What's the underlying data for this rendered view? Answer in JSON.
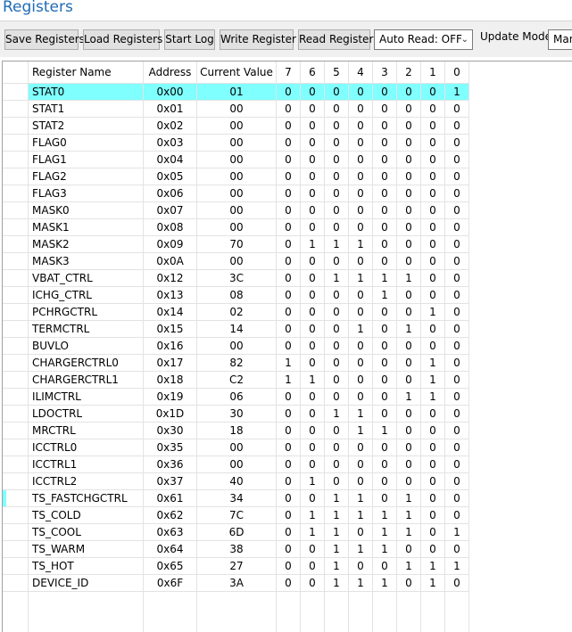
{
  "header": {
    "title": "Registers"
  },
  "toolbar": {
    "save_label": "Save Registers",
    "load_label": "Load Registers",
    "start_log_label": "Start Log",
    "write_label": "Write Register",
    "read_label": "Read Register",
    "auto_read_value": "Auto Read: OFF",
    "update_mode_label": "Update Mode",
    "update_mode_value": "Man"
  },
  "table": {
    "columns": [
      "Register Name",
      "Address",
      "Current Value",
      "7",
      "6",
      "5",
      "4",
      "3",
      "2",
      "1",
      "0"
    ],
    "selected_index": 0,
    "rows": [
      {
        "name": "STAT0",
        "address": "0x00",
        "value": "01",
        "bits": [
          "0",
          "0",
          "0",
          "0",
          "0",
          "0",
          "0",
          "1"
        ]
      },
      {
        "name": "STAT1",
        "address": "0x01",
        "value": "00",
        "bits": [
          "0",
          "0",
          "0",
          "0",
          "0",
          "0",
          "0",
          "0"
        ]
      },
      {
        "name": "STAT2",
        "address": "0x02",
        "value": "00",
        "bits": [
          "0",
          "0",
          "0",
          "0",
          "0",
          "0",
          "0",
          "0"
        ]
      },
      {
        "name": "FLAG0",
        "address": "0x03",
        "value": "00",
        "bits": [
          "0",
          "0",
          "0",
          "0",
          "0",
          "0",
          "0",
          "0"
        ]
      },
      {
        "name": "FLAG1",
        "address": "0x04",
        "value": "00",
        "bits": [
          "0",
          "0",
          "0",
          "0",
          "0",
          "0",
          "0",
          "0"
        ]
      },
      {
        "name": "FLAG2",
        "address": "0x05",
        "value": "00",
        "bits": [
          "0",
          "0",
          "0",
          "0",
          "0",
          "0",
          "0",
          "0"
        ]
      },
      {
        "name": "FLAG3",
        "address": "0x06",
        "value": "00",
        "bits": [
          "0",
          "0",
          "0",
          "0",
          "0",
          "0",
          "0",
          "0"
        ]
      },
      {
        "name": "MASK0",
        "address": "0x07",
        "value": "00",
        "bits": [
          "0",
          "0",
          "0",
          "0",
          "0",
          "0",
          "0",
          "0"
        ]
      },
      {
        "name": "MASK1",
        "address": "0x08",
        "value": "00",
        "bits": [
          "0",
          "0",
          "0",
          "0",
          "0",
          "0",
          "0",
          "0"
        ]
      },
      {
        "name": "MASK2",
        "address": "0x09",
        "value": "70",
        "bits": [
          "0",
          "1",
          "1",
          "1",
          "0",
          "0",
          "0",
          "0"
        ]
      },
      {
        "name": "MASK3",
        "address": "0x0A",
        "value": "00",
        "bits": [
          "0",
          "0",
          "0",
          "0",
          "0",
          "0",
          "0",
          "0"
        ]
      },
      {
        "name": "VBAT_CTRL",
        "address": "0x12",
        "value": "3C",
        "bits": [
          "0",
          "0",
          "1",
          "1",
          "1",
          "1",
          "0",
          "0"
        ]
      },
      {
        "name": "ICHG_CTRL",
        "address": "0x13",
        "value": "08",
        "bits": [
          "0",
          "0",
          "0",
          "0",
          "1",
          "0",
          "0",
          "0"
        ]
      },
      {
        "name": "PCHRGCTRL",
        "address": "0x14",
        "value": "02",
        "bits": [
          "0",
          "0",
          "0",
          "0",
          "0",
          "0",
          "1",
          "0"
        ]
      },
      {
        "name": "TERMCTRL",
        "address": "0x15",
        "value": "14",
        "bits": [
          "0",
          "0",
          "0",
          "1",
          "0",
          "1",
          "0",
          "0"
        ]
      },
      {
        "name": "BUVLO",
        "address": "0x16",
        "value": "00",
        "bits": [
          "0",
          "0",
          "0",
          "0",
          "0",
          "0",
          "0",
          "0"
        ]
      },
      {
        "name": "CHARGERCTRL0",
        "address": "0x17",
        "value": "82",
        "bits": [
          "1",
          "0",
          "0",
          "0",
          "0",
          "0",
          "1",
          "0"
        ]
      },
      {
        "name": "CHARGERCTRL1",
        "address": "0x18",
        "value": "C2",
        "bits": [
          "1",
          "1",
          "0",
          "0",
          "0",
          "0",
          "1",
          "0"
        ]
      },
      {
        "name": "ILIMCTRL",
        "address": "0x19",
        "value": "06",
        "bits": [
          "0",
          "0",
          "0",
          "0",
          "0",
          "1",
          "1",
          "0"
        ]
      },
      {
        "name": "LDOCTRL",
        "address": "0x1D",
        "value": "30",
        "bits": [
          "0",
          "0",
          "1",
          "1",
          "0",
          "0",
          "0",
          "0"
        ]
      },
      {
        "name": "MRCTRL",
        "address": "0x30",
        "value": "18",
        "bits": [
          "0",
          "0",
          "0",
          "1",
          "1",
          "0",
          "0",
          "0"
        ]
      },
      {
        "name": "ICCTRL0",
        "address": "0x35",
        "value": "00",
        "bits": [
          "0",
          "0",
          "0",
          "0",
          "0",
          "0",
          "0",
          "0"
        ]
      },
      {
        "name": "ICCTRL1",
        "address": "0x36",
        "value": "00",
        "bits": [
          "0",
          "0",
          "0",
          "0",
          "0",
          "0",
          "0",
          "0"
        ]
      },
      {
        "name": "ICCTRL2",
        "address": "0x37",
        "value": "40",
        "bits": [
          "0",
          "1",
          "0",
          "0",
          "0",
          "0",
          "0",
          "0"
        ]
      },
      {
        "name": "TS_FASTCHGCTRL",
        "address": "0x61",
        "value": "34",
        "bits": [
          "0",
          "0",
          "1",
          "1",
          "0",
          "1",
          "0",
          "0"
        ]
      },
      {
        "name": "TS_COLD",
        "address": "0x62",
        "value": "7C",
        "bits": [
          "0",
          "1",
          "1",
          "1",
          "1",
          "1",
          "0",
          "0"
        ]
      },
      {
        "name": "TS_COOL",
        "address": "0x63",
        "value": "6D",
        "bits": [
          "0",
          "1",
          "1",
          "0",
          "1",
          "1",
          "0",
          "1"
        ]
      },
      {
        "name": "TS_WARM",
        "address": "0x64",
        "value": "38",
        "bits": [
          "0",
          "0",
          "1",
          "1",
          "1",
          "0",
          "0",
          "0"
        ]
      },
      {
        "name": "TS_HOT",
        "address": "0x65",
        "value": "27",
        "bits": [
          "0",
          "0",
          "1",
          "0",
          "0",
          "1",
          "1",
          "1"
        ]
      },
      {
        "name": "DEVICE_ID",
        "address": "0x6F",
        "value": "3A",
        "bits": [
          "0",
          "0",
          "1",
          "1",
          "1",
          "0",
          "1",
          "0"
        ]
      }
    ]
  },
  "colors": {
    "title": "#1f6bb5",
    "selection": "#80ffff",
    "toolbar_bg": "#f0f0f0",
    "grid_line": "#e3e3e3"
  }
}
